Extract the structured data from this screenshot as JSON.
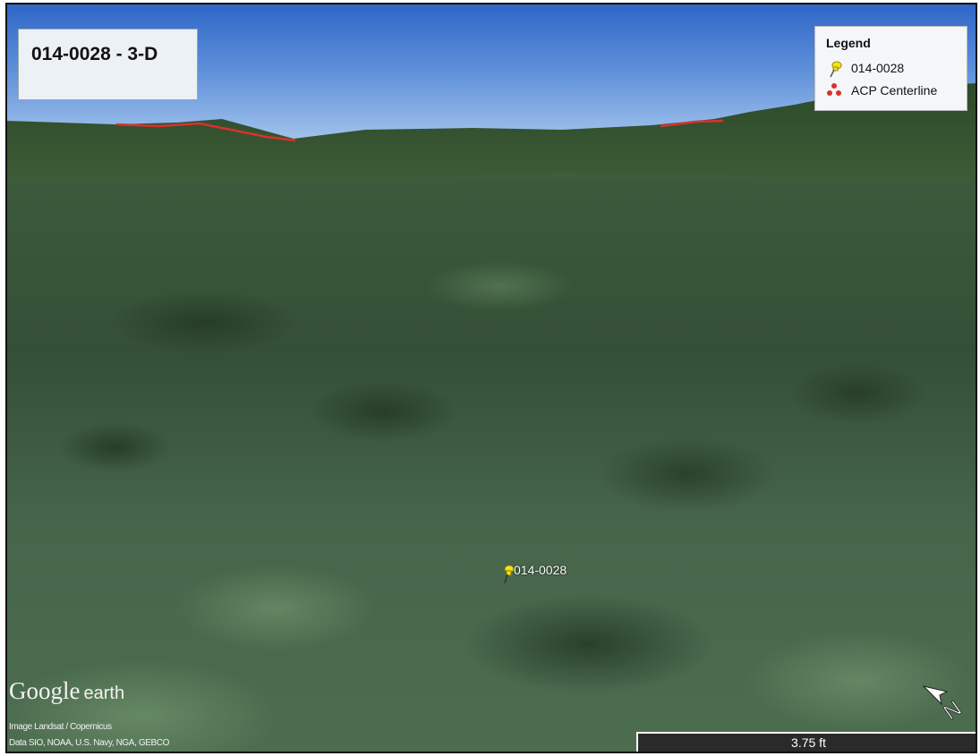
{
  "map": {
    "title": "014-0028 - 3-D",
    "legend": {
      "title": "Legend",
      "items": [
        {
          "label": "014-0028",
          "icon": "yellow-pushpin-icon",
          "color": "#f2e31a"
        },
        {
          "label": "ACP Centerline",
          "icon": "red-dots-icon",
          "color": "#d8322c"
        }
      ]
    },
    "placemark": {
      "label": "014-0028",
      "icon": "yellow-pushpin-icon"
    },
    "centerline_color": "#d8322c",
    "branding": {
      "google": "Google",
      "earth": "earth"
    },
    "credits": [
      "Image Landsat / Copernicus",
      "Data SIO, NOAA, U.S. Navy, NGA, GEBCO"
    ],
    "scale_label": "3.75 ft",
    "compass": {
      "icon": "north-arrow-icon",
      "letter": "N"
    }
  }
}
